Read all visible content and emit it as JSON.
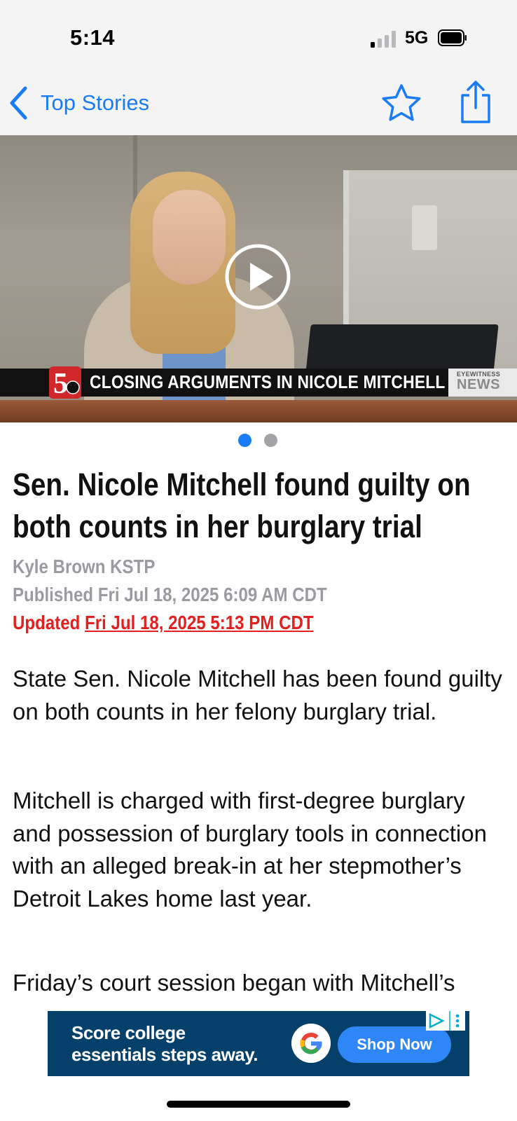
{
  "status_bar": {
    "time": "5:14",
    "network": "5G"
  },
  "nav": {
    "back_label": "Top Stories",
    "accent_color": "#1a7cf4"
  },
  "media": {
    "lower_third_text": "CLOSING ARGUMENTS IN NICOLE MITCHELL TRIAL",
    "lower_third_brand_small": "EYEWITNESS",
    "lower_third_brand": "NEWS",
    "logo_text": "5",
    "page_count": 2,
    "current_page": 1
  },
  "article": {
    "headline": "Sen. Nicole Mitchell found guilty on both counts in her burglary trial",
    "author": "Kyle Brown KSTP",
    "published": "Published Fri Jul 18, 2025 6:09 AM CDT",
    "updated_label": "Updated",
    "updated_date": "Fri Jul 18, 2025 5:13 PM CDT",
    "paragraphs": [
      "State Sen. Nicole Mitchell has been found guilty on both counts in her felony burglary trial.",
      "Mitchell is charged with first-degree burglary and possession of burglary tools in connection with an alleged break-in at her stepmother’s Detroit Lakes home last year.",
      "Friday’s court session began with Mitchell’s"
    ]
  },
  "ad": {
    "text_line1": "Score college",
    "text_line2": "essentials steps away.",
    "cta": "Shop Now",
    "brand_icon": "google-g-icon",
    "background_color": "#05406b"
  }
}
